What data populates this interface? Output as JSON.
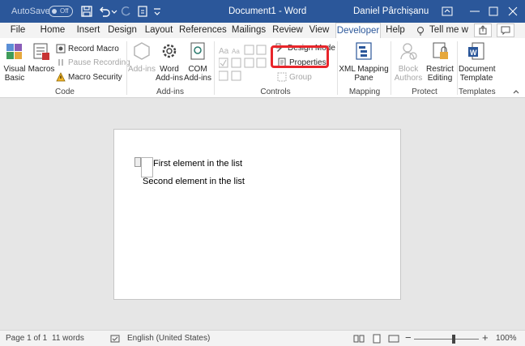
{
  "titlebar": {
    "autosave_label": "AutoSave",
    "autosave_state": "Off",
    "document_title": "Document1 - Word",
    "user_name": "Daniel Pârchișanu"
  },
  "tabs": [
    {
      "label": "File"
    },
    {
      "label": "Home"
    },
    {
      "label": "Insert"
    },
    {
      "label": "Design"
    },
    {
      "label": "Layout"
    },
    {
      "label": "References"
    },
    {
      "label": "Mailings"
    },
    {
      "label": "Review"
    },
    {
      "label": "View"
    },
    {
      "label": "Developer"
    },
    {
      "label": "Help"
    }
  ],
  "tell_me": "Tell me w",
  "ribbon": {
    "code": {
      "label": "Code",
      "visual_basic": "Visual Basic",
      "macros": "Macros",
      "record_macro": "Record Macro",
      "pause_recording": "Pause Recording",
      "macro_security": "Macro Security"
    },
    "addins": {
      "label": "Add-ins",
      "addins": "Add-ins",
      "word_addins": "Word Add-ins",
      "com_addins": "COM Add-ins"
    },
    "controls": {
      "label": "Controls",
      "design_mode": "Design Mode",
      "properties": "Properties",
      "group": "Group"
    },
    "mapping": {
      "label": "Mapping",
      "xml_mapping_pane": "XML Mapping Pane"
    },
    "protect": {
      "label": "Protect",
      "block_authors": "Block Authors",
      "restrict_editing": "Restrict Editing"
    },
    "templates": {
      "label": "Templates",
      "document_template": "Document Template"
    }
  },
  "document": {
    "line1": "First element in the list",
    "line2": "Second element in the list"
  },
  "statusbar": {
    "page": "Page 1 of 1",
    "words": "11 words",
    "language": "English (United States)",
    "zoom": "100%"
  },
  "colors": {
    "titlebar": "#2b579a",
    "highlight": "#e8262b"
  }
}
